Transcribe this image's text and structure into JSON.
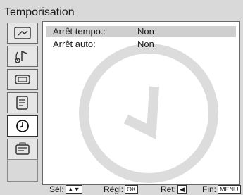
{
  "title": "Temporisation",
  "sidebar": {
    "items": [
      {
        "icon": "picture-icon"
      },
      {
        "icon": "sound-icon"
      },
      {
        "icon": "screen-icon"
      },
      {
        "icon": "channel-setup-icon"
      },
      {
        "icon": "timer-clock-icon",
        "active": true
      },
      {
        "icon": "settings-icon"
      }
    ]
  },
  "menu": {
    "rows": [
      {
        "label": "Arrêt tempo.:",
        "value": "Non"
      },
      {
        "label": "Arrêt auto:",
        "value": "Non"
      }
    ]
  },
  "footer": {
    "sel_label": "Sél:",
    "sel_keys": "▲▼",
    "reg_label": "Régl:",
    "reg_key": "OK",
    "ret_label": "Ret:",
    "ret_key": "◀",
    "fin_label": "Fin:",
    "fin_key": "MENU"
  }
}
